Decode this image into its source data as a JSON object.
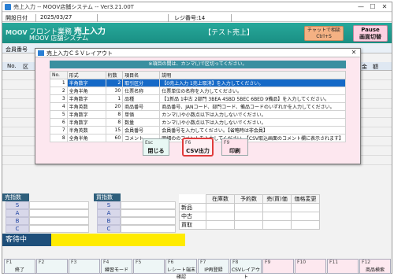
{
  "window": {
    "title": "売上入力 -- MOOV店舗システム -- Ver3.21.00T",
    "minimize": "—",
    "maximize": "☐",
    "close": "✕"
  },
  "infobar": {
    "date_label": "開設日付",
    "date_value": "2025/03/27",
    "register_label": "レジ番号:14"
  },
  "header": {
    "logo": "MOOV",
    "dept": "フロント業務",
    "screen": "売上入力",
    "system": "MOOV 店舗システム",
    "test_label": "【テスト売上】",
    "chat_button": "チャットで相談",
    "chat_key": "Ctrl+S",
    "pause_button_line1": "Pause",
    "pause_button_line2": "画面切替"
  },
  "main": {
    "member_label": "会員番号",
    "col_no": "No.",
    "col_kubun": "区",
    "col_amount": "金　額"
  },
  "dialog": {
    "title": "売上入力ＣＳＶレイアウト",
    "close": "✕",
    "note": "※項目の間は、カンマ(,)で区切ってください。",
    "columns": [
      "No.",
      "形式",
      "桁数",
      "項目名",
      "説明"
    ],
    "rows": [
      {
        "no": "1",
        "type": "半角数字",
        "digits": "2",
        "name": "取引区分",
        "desc": "【0売上入力 1売上取消】を入力してください。"
      },
      {
        "no": "2",
        "type": "全角半角",
        "digits": "30",
        "name": "仕票名称",
        "desc": "仕票単位の名称を入力してください。"
      },
      {
        "no": "3",
        "type": "半角数字",
        "digits": "1",
        "name": "品種",
        "desc": "【1新品 1中古 2部門 3BEA 4SBD 5BEC 6BED 9備品】を入力してください。"
      },
      {
        "no": "4",
        "type": "半角英数",
        "digits": "20",
        "name": "商品番号",
        "desc": "商品番号、JANコード、部門コード、備品コードのいずれかを入力してください。"
      },
      {
        "no": "5",
        "type": "半角数字",
        "digits": "8",
        "name": "単価",
        "desc": "カンマ(,)や小数点以下は入力しないでください。"
      },
      {
        "no": "6",
        "type": "半角数字",
        "digits": "8",
        "name": "数量",
        "desc": "カンマ(,)や小数点以下は入力しないでください。"
      },
      {
        "no": "7",
        "type": "半角英数",
        "digits": "15",
        "name": "会員番号",
        "desc": "会員番号を入力してください。【省略時は非会員】"
      },
      {
        "no": "8",
        "type": "全角半角",
        "digits": "60",
        "name": "コメント",
        "desc": "明細ののコメントを入力してください。【CSV取込画面のコメント欄に表示されます】"
      }
    ],
    "buttons": [
      {
        "key": "Esc",
        "label": "閉じる"
      },
      {
        "key": "F6",
        "label": "CSV出力"
      },
      {
        "key": "F9",
        "label": "印刷"
      }
    ]
  },
  "panels": {
    "sell_label": "売指数",
    "buy_label": "買指数",
    "grades": [
      "S",
      "A",
      "B",
      "C"
    ],
    "stock_headers": [
      "在庫数",
      "予約数",
      "売(買)価",
      "価格変更"
    ],
    "stock_rows": [
      "新品",
      "中古",
      "買取"
    ],
    "waiting": "客待中"
  },
  "fkeys": [
    {
      "key": "F1",
      "label": "終了"
    },
    {
      "key": "F2",
      "label": ""
    },
    {
      "key": "F3",
      "label": ""
    },
    {
      "key": "F4",
      "label": "練習モード"
    },
    {
      "key": "F5",
      "label": ""
    },
    {
      "key": "F6",
      "label": "レシート端末確認"
    },
    {
      "key": "F7",
      "label": "IP再登録"
    },
    {
      "key": "F8",
      "label": "CSVレイアウト"
    },
    {
      "key": "F9",
      "label": ""
    },
    {
      "key": "F10",
      "label": ""
    },
    {
      "key": "F11",
      "label": ""
    },
    {
      "key": "F12",
      "label": "商品検索"
    }
  ],
  "colors": {
    "header_teal": "#1a8f83",
    "selection_blue": "#1569c7",
    "dialog_pink": "#fde7ef",
    "waiting_bar": "#ffeb00",
    "highlight_red": "#e03b3b"
  }
}
